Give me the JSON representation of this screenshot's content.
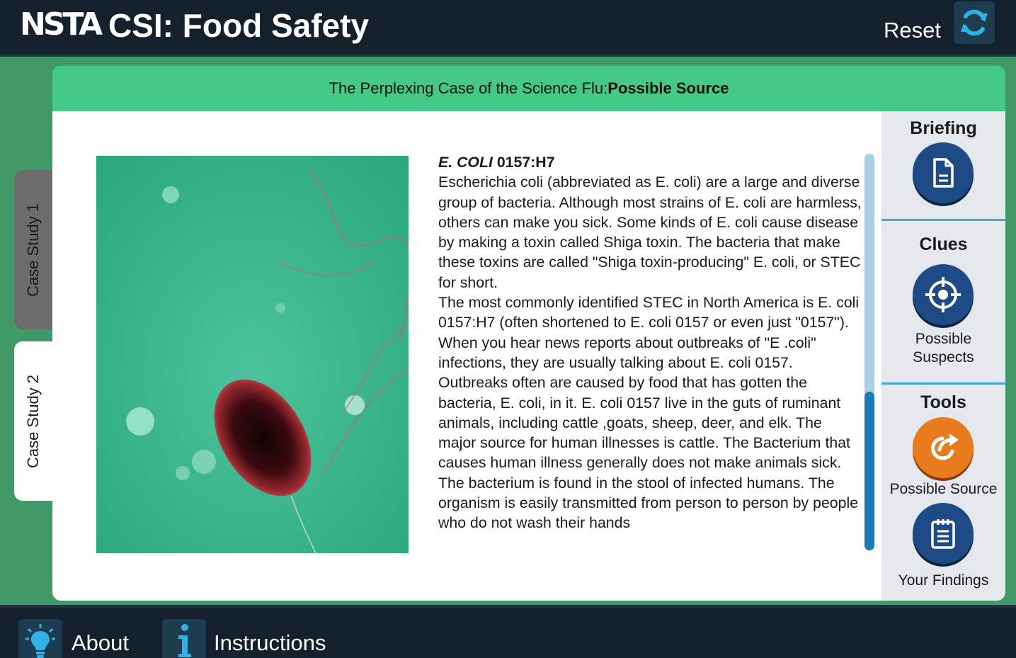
{
  "header": {
    "logo": "NSTA",
    "title": "CSI: Food Safety",
    "reset_label": "Reset",
    "reset_icon": "refresh-icon"
  },
  "card": {
    "heading_prefix": "The Perplexing Case of the Science Flu:",
    "heading_bold": "Possible Source"
  },
  "tabs": [
    {
      "label": "Case Study 1",
      "active": false
    },
    {
      "label": "Case Study 2",
      "active": true
    }
  ],
  "article": {
    "title_italic": "E. COLI",
    "title_rest": " 0157:H7",
    "paragraphs": [
      "Escherichia coli (abbreviated as E. coli) are a large and diverse group of bacteria. Although most strains of E. coli are harmless, others can make you sick. Some kinds of E. coli cause disease by making a toxin called Shiga toxin. The bacteria that make these toxins are called \"Shiga toxin-producing\" E. coli, or STEC for short.",
      "The most commonly identified STEC in North America is E. coli 0157:H7 (often shortened to E. coli 0157 or even just \"0157\"). When you hear news reports about outbreaks of \"E .coli\" infections, they are usually talking about E. coli 0157.",
      "Outbreaks often are caused by food that has gotten the bacteria, E. coli, in it. E. coli 0157 live in the guts of ruminant animals, including cattle ,goats, sheep, deer, and elk. The major source for human illnesses is cattle. The Bacterium that causes human illness generally does not make animals sick. The bacterium is found in the stool of infected humans. The organism is easily transmitted from person to person by people who do not wash their hands"
    ]
  },
  "panel": {
    "briefing": {
      "title": "Briefing",
      "icon": "document-icon"
    },
    "clues": {
      "title": "Clues",
      "icon": "crosshair-icon",
      "label": "Possible Suspects"
    },
    "tools": {
      "title": "Tools",
      "source": {
        "icon": "share-arrow-icon",
        "label": "Possible Source"
      },
      "findings": {
        "icon": "notepad-icon",
        "label": "Your Findings"
      }
    }
  },
  "footer": {
    "about_label": "About",
    "about_icon": "lightbulb-icon",
    "instructions_label": "Instructions",
    "instructions_icon": "info-icon"
  },
  "colors": {
    "header_bg": "#14212c",
    "page_bg": "#3f9a68",
    "card_head": "#44c987",
    "button_blue": "#1e4a86",
    "button_orange": "#e87b1d",
    "scroll_thumb": "#1a7ab4"
  }
}
